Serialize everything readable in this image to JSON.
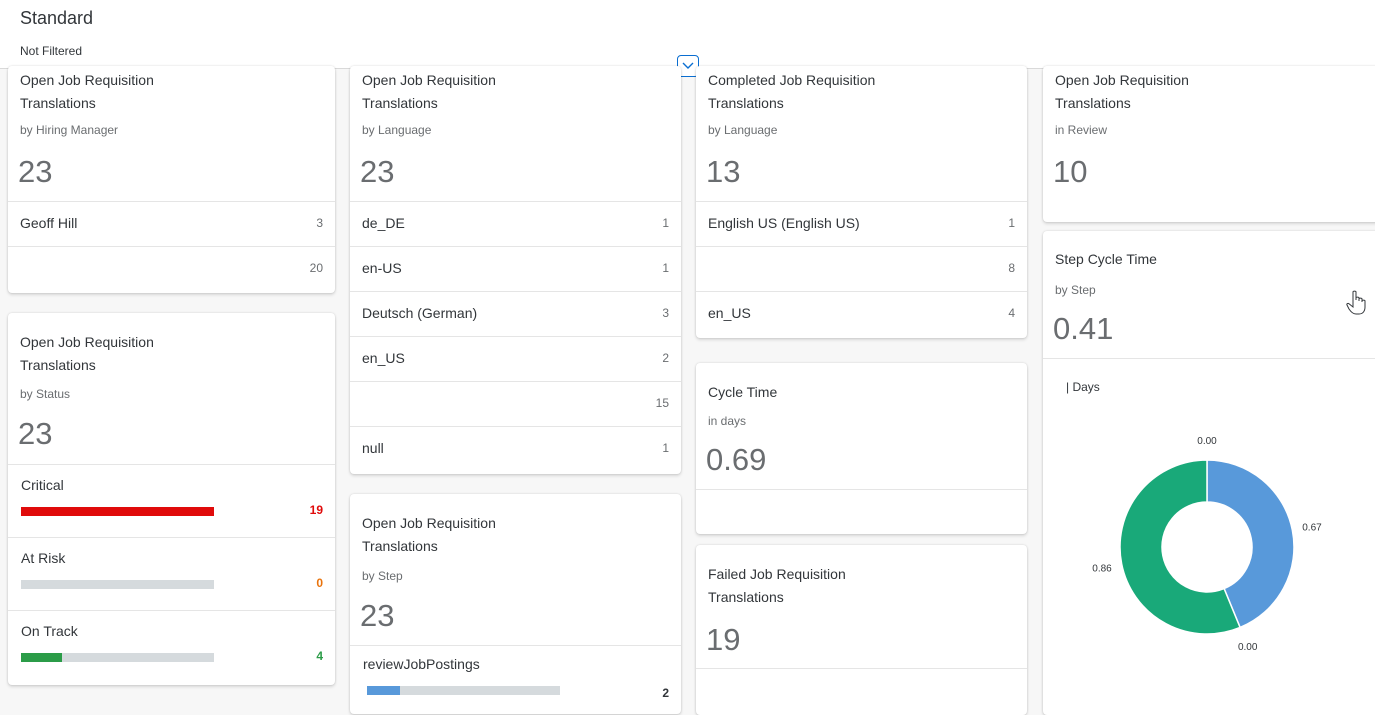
{
  "header": {
    "title": "Standard",
    "filter_status": "Not Filtered"
  },
  "colors": {
    "critical": "#e00b0b",
    "risk": "#e9730c",
    "good": "#2b9c48",
    "blue": "#5899da",
    "teal": "#19a979"
  },
  "cards": {
    "hiring_manager": {
      "title1": "Open Job Requisition",
      "title2": "Translations",
      "subtitle": "by Hiring Manager",
      "kpi": "23",
      "rows": [
        {
          "label": "Geoff Hill",
          "value": "3"
        },
        {
          "label": "",
          "value": "20"
        }
      ]
    },
    "by_status": {
      "title1": "Open Job Requisition",
      "title2": "Translations",
      "subtitle": "by Status",
      "kpi": "23",
      "rows": [
        {
          "label": "Critical",
          "value": "19",
          "fraction": 1.0
        },
        {
          "label": "At Risk",
          "value": "0",
          "fraction": 0.0
        },
        {
          "label": "On Track",
          "value": "4",
          "fraction": 0.21
        }
      ]
    },
    "by_language": {
      "title1": "Open Job Requisition",
      "title2": "Translations",
      "subtitle": "by Language",
      "kpi": "23",
      "rows": [
        {
          "label": "de_DE",
          "value": "1"
        },
        {
          "label": "en-US",
          "value": "1"
        },
        {
          "label": "Deutsch (German)",
          "value": "3"
        },
        {
          "label": "en_US",
          "value": "2"
        },
        {
          "label": "",
          "value": "15"
        },
        {
          "label": "null",
          "value": "1"
        }
      ]
    },
    "by_step": {
      "title1": "Open Job Requisition",
      "title2": "Translations",
      "subtitle": "by Step",
      "kpi": "23",
      "rows": [
        {
          "label": "reviewJobPostings",
          "value": "2",
          "fraction": 0.17
        }
      ]
    },
    "completed": {
      "title1": "Completed Job Requisition",
      "title2": "Translations",
      "subtitle": "by Language",
      "kpi": "13",
      "rows": [
        {
          "label": "English US (English US)",
          "value": "1"
        },
        {
          "label": "",
          "value": "8"
        },
        {
          "label": "en_US",
          "value": "4"
        }
      ]
    },
    "cycle_time": {
      "title1": "Cycle Time",
      "subtitle": "in days",
      "kpi": "0.69"
    },
    "failed": {
      "title1": "Failed Job Requisition",
      "title2": "Translations",
      "kpi": "19"
    },
    "in_review": {
      "title1": "Open Job Requisition",
      "title2": "Translations",
      "subtitle": "in Review",
      "kpi": "10"
    },
    "step_cycle": {
      "title1": "Step Cycle Time",
      "subtitle": "by Step",
      "kpi": "0.41",
      "legend": "| Days"
    }
  },
  "chart_data": {
    "type": "pie",
    "style": "donut",
    "legend_text": "| Days",
    "slices": [
      {
        "value": 0.67,
        "label": "0.67",
        "color": "#5899da"
      },
      {
        "value": 0.0,
        "label": "0.00",
        "color": "#e8743b"
      },
      {
        "value": 0.86,
        "label": "0.86",
        "color": "#19a979"
      },
      {
        "value": 0.0,
        "label": "0.00",
        "color": "#ed4a7b"
      }
    ]
  }
}
